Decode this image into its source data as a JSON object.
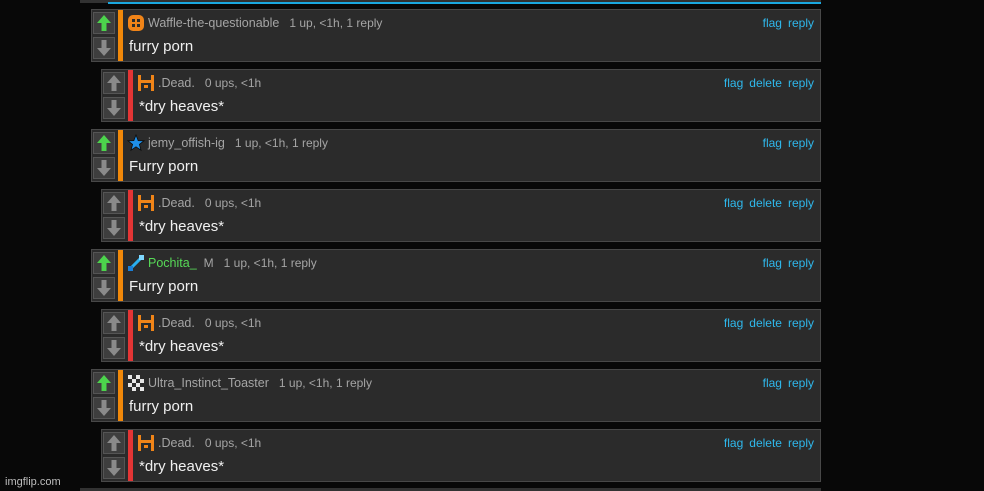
{
  "comments": [
    {
      "kind": "parent",
      "username": "Waffle-the-questionable",
      "avatar": "orange-waffle-icon",
      "badge": "",
      "meta": "1 up, <1h, 1 reply",
      "actions": [
        "flag",
        "reply"
      ],
      "text": "furry porn",
      "upvoted": true
    },
    {
      "kind": "reply",
      "username": ".Dead.",
      "avatar": "orange-cat-icon",
      "badge": "",
      "meta": "0 ups, <1h",
      "actions": [
        "flag",
        "delete",
        "reply"
      ],
      "text": "*dry heaves*",
      "upvoted": false
    },
    {
      "kind": "parent",
      "username": "jemy_offish-ig",
      "avatar": "blue-star-icon",
      "badge": "",
      "meta": "1 up, <1h, 1 reply",
      "actions": [
        "flag",
        "reply"
      ],
      "text": "Furry porn",
      "upvoted": true
    },
    {
      "kind": "reply",
      "username": ".Dead.",
      "avatar": "orange-cat-icon",
      "badge": "",
      "meta": "0 ups, <1h",
      "actions": [
        "flag",
        "delete",
        "reply"
      ],
      "text": "*dry heaves*",
      "upvoted": false
    },
    {
      "kind": "parent",
      "username": "Pochita_",
      "avatar": "blue-sword-icon",
      "badge": "M",
      "meta": "1 up, <1h, 1 reply",
      "actions": [
        "flag",
        "reply"
      ],
      "text": "Furry porn",
      "upvoted": true
    },
    {
      "kind": "reply",
      "username": ".Dead.",
      "avatar": "orange-cat-icon",
      "badge": "",
      "meta": "0 ups, <1h",
      "actions": [
        "flag",
        "delete",
        "reply"
      ],
      "text": "*dry heaves*",
      "upvoted": false
    },
    {
      "kind": "parent",
      "username": "Ultra_Instinct_Toaster",
      "avatar": "checker-pattern-icon",
      "badge": "",
      "meta": "1 up, <1h, 1 reply",
      "actions": [
        "flag",
        "reply"
      ],
      "text": "furry porn",
      "upvoted": true
    },
    {
      "kind": "reply",
      "username": ".Dead.",
      "avatar": "orange-cat-icon",
      "badge": "",
      "meta": "0 ups, <1h",
      "actions": [
        "flag",
        "delete",
        "reply"
      ],
      "text": "*dry heaves*",
      "upvoted": false
    }
  ],
  "watermark": "imgflip.com",
  "colors": {
    "upvote_active": "#4cd44c",
    "vote_inactive": "#8a8a8a",
    "parent_stripe": "#f0880a",
    "reply_stripe": "#e33535",
    "link": "#2fb8ec",
    "special_username": "#57d957"
  }
}
